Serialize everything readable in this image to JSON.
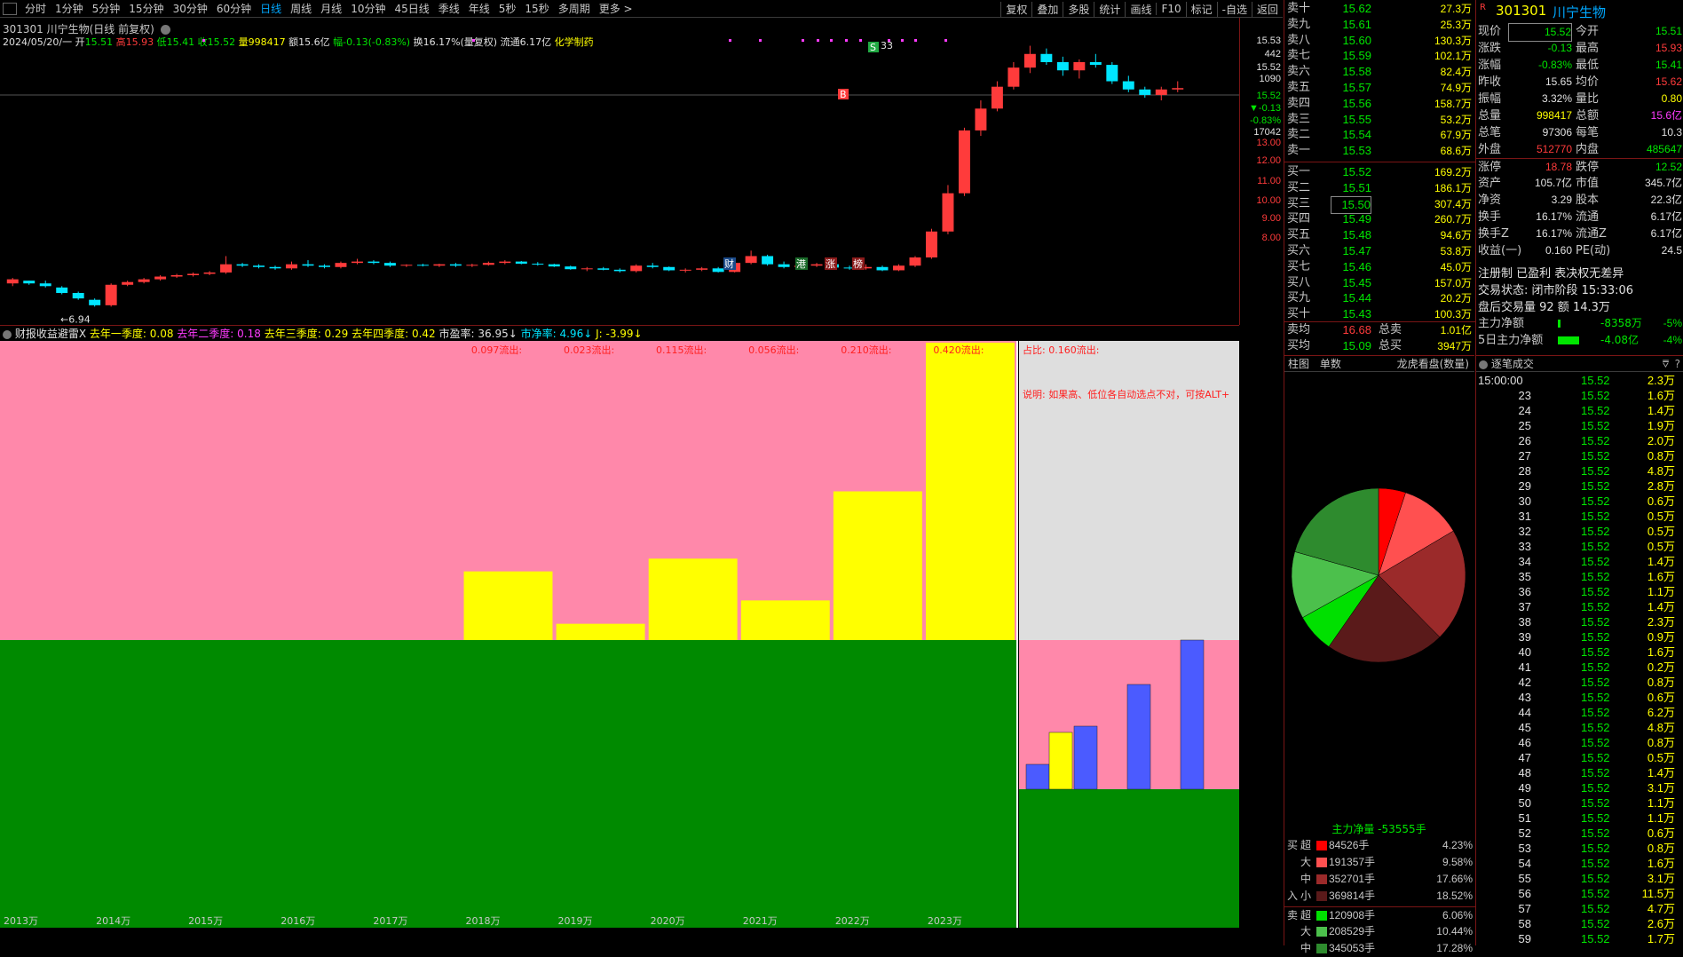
{
  "toolbar": {
    "periods": [
      "分时",
      "1分钟",
      "5分钟",
      "15分钟",
      "30分钟",
      "60分钟",
      "日线",
      "周线",
      "月线",
      "10分钟",
      "45日线",
      "季线",
      "年线",
      "5秒",
      "15秒",
      "多周期",
      "更多 >"
    ],
    "active": "日线",
    "right": [
      "复权",
      "叠加",
      "多股",
      "统计",
      "画线",
      "F10",
      "标记",
      "-自选",
      "返回"
    ]
  },
  "stock": {
    "title": "301301 川宁生物(日线 前复权)",
    "date": "2024/05/20/一",
    "open_label": "开",
    "open": "15.51",
    "high_label": "高",
    "high": "15.93",
    "low_label": "低",
    "low": "15.41",
    "close_label": "收",
    "close": "15.52",
    "vol_label": "量",
    "vol": "998417",
    "amount": "额15.6亿",
    "change": "幅-0.13(-0.83%)",
    "turnover": "换16.17%(量复权)",
    "float_cap": "流通6.17亿",
    "sector": "化学制药"
  },
  "price_axis": {
    "top_labels": [
      "15.53",
      "442",
      "15.52",
      "1090",
      "15.52",
      "▼-0.13",
      "-0.83%",
      "17042"
    ],
    "labels": [
      "13.00",
      "12.00",
      "11.00",
      "10.00",
      "9.00",
      "8.00"
    ],
    "low_mark": "←6.94",
    "high_mark": "33"
  },
  "badges": [
    "财",
    "港",
    "涨",
    "榜"
  ],
  "indicator": {
    "name": "财报收益避雷X",
    "q1": "去年一季度: 0.08",
    "q2": "去年二季度: 0.18",
    "q3": "去年三季度: 0.29",
    "q4": "去年四季度: 0.42",
    "pe": "市盈率: 36.95↓",
    "pb": "市净率: 4.96↓",
    "j": "J: -3.99↓",
    "outflow_labels": [
      "0.097流出:",
      "0.023流出:",
      "0.115流出:",
      "0.056流出:",
      "0.210流出:",
      "0.420流出:"
    ],
    "ratio_label": "占比: 0.160流出:",
    "note": "说明: 如果高、低位各自动选点不对，可按ALT+",
    "years": [
      "2013万",
      "2014万",
      "2015万",
      "2016万",
      "2017万",
      "2018万",
      "2019万",
      "2020万",
      "2021万",
      "2022万",
      "2023万"
    ]
  },
  "chart_data": {
    "type": "bar",
    "categories": [
      "2013",
      "2014",
      "2015",
      "2016",
      "2017",
      "2018",
      "2019",
      "2020",
      "2021",
      "2022",
      "2023"
    ],
    "values": [
      0,
      0,
      0,
      0,
      0,
      0.097,
      0.023,
      0.115,
      0.056,
      0.21,
      0.42
    ],
    "side_ratio": 0.16
  },
  "orderbook": {
    "asks": [
      {
        "label": "卖十",
        "price": "15.62",
        "vol": "27.3万"
      },
      {
        "label": "卖九",
        "price": "15.61",
        "vol": "25.3万"
      },
      {
        "label": "卖八",
        "price": "15.60",
        "vol": "130.3万"
      },
      {
        "label": "卖七",
        "price": "15.59",
        "vol": "102.1万"
      },
      {
        "label": "卖六",
        "price": "15.58",
        "vol": "82.4万"
      },
      {
        "label": "卖五",
        "price": "15.57",
        "vol": "74.9万"
      },
      {
        "label": "卖四",
        "price": "15.56",
        "vol": "158.7万"
      },
      {
        "label": "卖三",
        "price": "15.55",
        "vol": "53.2万"
      },
      {
        "label": "卖二",
        "price": "15.54",
        "vol": "67.9万"
      },
      {
        "label": "卖一",
        "price": "15.53",
        "vol": "68.6万"
      }
    ],
    "bids": [
      {
        "label": "买一",
        "price": "15.52",
        "vol": "169.2万"
      },
      {
        "label": "买二",
        "price": "15.51",
        "vol": "186.1万"
      },
      {
        "label": "买三",
        "price": "15.50",
        "vol": "307.4万"
      },
      {
        "label": "买四",
        "price": "15.49",
        "vol": "260.7万"
      },
      {
        "label": "买五",
        "price": "15.48",
        "vol": "94.6万"
      },
      {
        "label": "买六",
        "price": "15.47",
        "vol": "53.8万"
      },
      {
        "label": "买七",
        "price": "15.46",
        "vol": "45.0万"
      },
      {
        "label": "买八",
        "price": "15.45",
        "vol": "157.0万"
      },
      {
        "label": "买九",
        "price": "15.44",
        "vol": "20.2万"
      },
      {
        "label": "买十",
        "price": "15.43",
        "vol": "100.3万"
      }
    ],
    "sell_avg_label": "卖均",
    "sell_avg": "16.68",
    "sell_total_label": "总卖",
    "sell_total": "1.01亿",
    "buy_avg_label": "买均",
    "buy_avg": "15.09",
    "buy_total_label": "总买",
    "buy_total": "3947万"
  },
  "quote": {
    "code": "301301",
    "name": "川宁生物",
    "rows": [
      [
        "现价",
        "15.52",
        "今开",
        "15.51"
      ],
      [
        "涨跌",
        "-0.13",
        "最高",
        "15.93"
      ],
      [
        "涨幅",
        "-0.83%",
        "最低",
        "15.41"
      ],
      [
        "昨收",
        "15.65",
        "均价",
        "15.62"
      ],
      [
        "振幅",
        "3.32%",
        "量比",
        "0.80"
      ],
      [
        "总量",
        "998417",
        "总额",
        "15.6亿"
      ],
      [
        "总笔",
        "97306",
        "每笔",
        "10.3"
      ],
      [
        "外盘",
        "512770",
        "内盘",
        "485647"
      ],
      [
        "涨停",
        "18.78",
        "跌停",
        "12.52"
      ],
      [
        "资产",
        "105.7亿",
        "市值",
        "345.7亿"
      ],
      [
        "净资",
        "3.29",
        "股本",
        "22.3亿"
      ],
      [
        "换手",
        "16.17%",
        "流通",
        "6.17亿"
      ],
      [
        "换手Z",
        "16.17%",
        "流通Z",
        "6.17亿"
      ],
      [
        "收益(一)",
        "0.160",
        "PE(动)",
        "24.5"
      ]
    ],
    "reg": "注册制 已盈利 表决权无差异",
    "status": "交易状态: 闭市阶段 15:33:06",
    "after": "盘后交易量 92 额 14.3万",
    "main_net_label": "主力净额",
    "main_net": "-8358万",
    "main_net_pct": "-5%",
    "five_day_label": "5日主力净额",
    "five_day": "-4.08亿",
    "five_day_pct": "-4%"
  },
  "funds": {
    "tabs": [
      "柱图",
      "单数"
    ],
    "title": "龙虎看盘(数量)",
    "pie": [
      84526,
      191357,
      352701,
      369814,
      120908,
      208529,
      345053
    ],
    "pie_colors": [
      "#ff0000",
      "#ff5050",
      "#9b2a2a",
      "#5a1a1a",
      "#00e000",
      "#4cc04c",
      "#2e8b2e"
    ],
    "main_net": "主力净量 -53555手",
    "rows": [
      {
        "side": "买",
        "size": "超",
        "val": "84526手",
        "pct": "4.23%",
        "color": "#ff0000"
      },
      {
        "side": "",
        "size": "大",
        "val": "191357手",
        "pct": "9.58%",
        "color": "#ff5050"
      },
      {
        "side": "",
        "size": "中",
        "val": "352701手",
        "pct": "17.66%",
        "color": "#9b2a2a"
      },
      {
        "side": "入",
        "size": "小",
        "val": "369814手",
        "pct": "18.52%",
        "color": "#5a1a1a"
      },
      {
        "side": "卖",
        "size": "超",
        "val": "120908手",
        "pct": "6.06%",
        "color": "#00e000"
      },
      {
        "side": "",
        "size": "大",
        "val": "208529手",
        "pct": "10.44%",
        "color": "#4cc04c"
      },
      {
        "side": "",
        "size": "中",
        "val": "345053手",
        "pct": "17.28%",
        "color": "#2e8b2e"
      }
    ]
  },
  "trades": {
    "title": "逐笔成交",
    "rows": [
      [
        "15:00:00",
        "15.52",
        "2.3万"
      ],
      [
        "23",
        "15.52",
        "1.6万"
      ],
      [
        "24",
        "15.52",
        "1.4万"
      ],
      [
        "25",
        "15.52",
        "1.9万"
      ],
      [
        "26",
        "15.52",
        "2.0万"
      ],
      [
        "27",
        "15.52",
        "0.8万"
      ],
      [
        "28",
        "15.52",
        "4.8万"
      ],
      [
        "29",
        "15.52",
        "2.8万"
      ],
      [
        "30",
        "15.52",
        "0.6万"
      ],
      [
        "31",
        "15.52",
        "0.5万"
      ],
      [
        "32",
        "15.52",
        "0.5万"
      ],
      [
        "33",
        "15.52",
        "0.5万"
      ],
      [
        "34",
        "15.52",
        "1.4万"
      ],
      [
        "35",
        "15.52",
        "1.6万"
      ],
      [
        "36",
        "15.52",
        "1.1万"
      ],
      [
        "37",
        "15.52",
        "1.4万"
      ],
      [
        "38",
        "15.52",
        "2.3万"
      ],
      [
        "39",
        "15.52",
        "0.9万"
      ],
      [
        "40",
        "15.52",
        "1.6万"
      ],
      [
        "41",
        "15.52",
        "0.2万"
      ],
      [
        "42",
        "15.52",
        "0.8万"
      ],
      [
        "43",
        "15.52",
        "0.6万"
      ],
      [
        "44",
        "15.52",
        "6.2万"
      ],
      [
        "45",
        "15.52",
        "4.8万"
      ],
      [
        "46",
        "15.52",
        "0.8万"
      ],
      [
        "47",
        "15.52",
        "0.5万"
      ],
      [
        "48",
        "15.52",
        "1.4万"
      ],
      [
        "49",
        "15.52",
        "3.1万"
      ],
      [
        "50",
        "15.52",
        "1.1万"
      ],
      [
        "51",
        "15.52",
        "1.1万"
      ],
      [
        "52",
        "15.52",
        "0.6万"
      ],
      [
        "53",
        "15.52",
        "0.8万"
      ],
      [
        "54",
        "15.52",
        "1.6万"
      ],
      [
        "55",
        "15.52",
        "3.1万"
      ],
      [
        "56",
        "15.52",
        "11.5万"
      ],
      [
        "57",
        "15.52",
        "4.7万"
      ],
      [
        "58",
        "15.52",
        "2.6万"
      ],
      [
        "59",
        "15.52",
        "1.7万"
      ]
    ]
  },
  "candles": [
    [
      6.9,
      7.1,
      6.8,
      7.05
    ],
    [
      7.0,
      7.0,
      6.85,
      6.9
    ],
    [
      6.9,
      7.0,
      6.75,
      6.8
    ],
    [
      6.75,
      6.8,
      6.5,
      6.55
    ],
    [
      6.55,
      6.6,
      6.3,
      6.35
    ],
    [
      6.3,
      6.35,
      6.05,
      6.1
    ],
    [
      6.1,
      6.9,
      6.05,
      6.85
    ],
    [
      6.85,
      7.0,
      6.8,
      6.95
    ],
    [
      6.95,
      7.1,
      6.9,
      7.05
    ],
    [
      7.05,
      7.2,
      7.0,
      7.15
    ],
    [
      7.15,
      7.25,
      7.1,
      7.2
    ],
    [
      7.2,
      7.3,
      7.15,
      7.25
    ],
    [
      7.25,
      7.35,
      7.2,
      7.3
    ],
    [
      7.3,
      7.9,
      7.25,
      7.6
    ],
    [
      7.6,
      7.65,
      7.5,
      7.55
    ],
    [
      7.55,
      7.6,
      7.45,
      7.5
    ],
    [
      7.5,
      7.55,
      7.4,
      7.45
    ],
    [
      7.45,
      7.7,
      7.4,
      7.6
    ],
    [
      7.6,
      7.75,
      7.5,
      7.55
    ],
    [
      7.55,
      7.6,
      7.45,
      7.5
    ],
    [
      7.5,
      7.7,
      7.45,
      7.65
    ],
    [
      7.65,
      7.8,
      7.6,
      7.7
    ],
    [
      7.7,
      7.75,
      7.6,
      7.65
    ],
    [
      7.65,
      7.7,
      7.5,
      7.55
    ],
    [
      7.55,
      7.6,
      7.5,
      7.58
    ],
    [
      7.58,
      7.62,
      7.52,
      7.55
    ],
    [
      7.55,
      7.62,
      7.5,
      7.6
    ],
    [
      7.6,
      7.65,
      7.5,
      7.55
    ],
    [
      7.55,
      7.62,
      7.5,
      7.58
    ],
    [
      7.58,
      7.7,
      7.55,
      7.65
    ],
    [
      7.65,
      7.75,
      7.6,
      7.7
    ],
    [
      7.7,
      7.72,
      7.6,
      7.62
    ],
    [
      7.62,
      7.68,
      7.55,
      7.6
    ],
    [
      7.6,
      7.62,
      7.5,
      7.52
    ],
    [
      7.52,
      7.55,
      7.4,
      7.42
    ],
    [
      7.42,
      7.5,
      7.35,
      7.45
    ],
    [
      7.45,
      7.5,
      7.38,
      7.4
    ],
    [
      7.4,
      7.45,
      7.3,
      7.35
    ],
    [
      7.35,
      7.6,
      7.3,
      7.55
    ],
    [
      7.55,
      7.65,
      7.45,
      7.5
    ],
    [
      7.5,
      7.52,
      7.35,
      7.38
    ],
    [
      7.38,
      7.45,
      7.3,
      7.4
    ],
    [
      7.4,
      7.5,
      7.35,
      7.45
    ],
    [
      7.45,
      7.5,
      7.3,
      7.32
    ],
    [
      7.32,
      7.7,
      7.3,
      7.65
    ],
    [
      7.65,
      8.1,
      7.6,
      7.9
    ],
    [
      7.9,
      7.95,
      7.55,
      7.6
    ],
    [
      7.6,
      7.7,
      7.45,
      7.5
    ],
    [
      7.5,
      7.6,
      7.45,
      7.55
    ],
    [
      7.55,
      7.65,
      7.5,
      7.6
    ],
    [
      7.6,
      7.65,
      7.45,
      7.48
    ],
    [
      7.48,
      7.55,
      7.4,
      7.45
    ],
    [
      7.45,
      7.6,
      7.4,
      7.5
    ],
    [
      7.5,
      7.55,
      7.35,
      7.38
    ],
    [
      7.38,
      7.6,
      7.35,
      7.55
    ],
    [
      7.55,
      7.9,
      7.5,
      7.85
    ],
    [
      7.85,
      8.9,
      7.8,
      8.8
    ],
    [
      8.8,
      10.5,
      8.7,
      10.2
    ],
    [
      10.2,
      12.6,
      10.1,
      12.5
    ],
    [
      12.5,
      13.6,
      12.3,
      13.3
    ],
    [
      13.3,
      14.3,
      13.2,
      14.1
    ],
    [
      14.1,
      15.0,
      14.0,
      14.8
    ],
    [
      14.8,
      15.6,
      14.6,
      15.3
    ],
    [
      15.3,
      15.5,
      14.9,
      15.0
    ],
    [
      15.0,
      15.2,
      14.5,
      14.7
    ],
    [
      14.7,
      15.1,
      14.4,
      15.0
    ],
    [
      15.0,
      15.3,
      14.8,
      14.9
    ],
    [
      14.9,
      15.0,
      14.2,
      14.3
    ],
    [
      14.3,
      14.5,
      13.9,
      14.0
    ],
    [
      14.0,
      14.1,
      13.7,
      13.8
    ],
    [
      13.8,
      14.1,
      13.6,
      14.0
    ],
    [
      14.0,
      14.3,
      13.9,
      14.05
    ]
  ]
}
